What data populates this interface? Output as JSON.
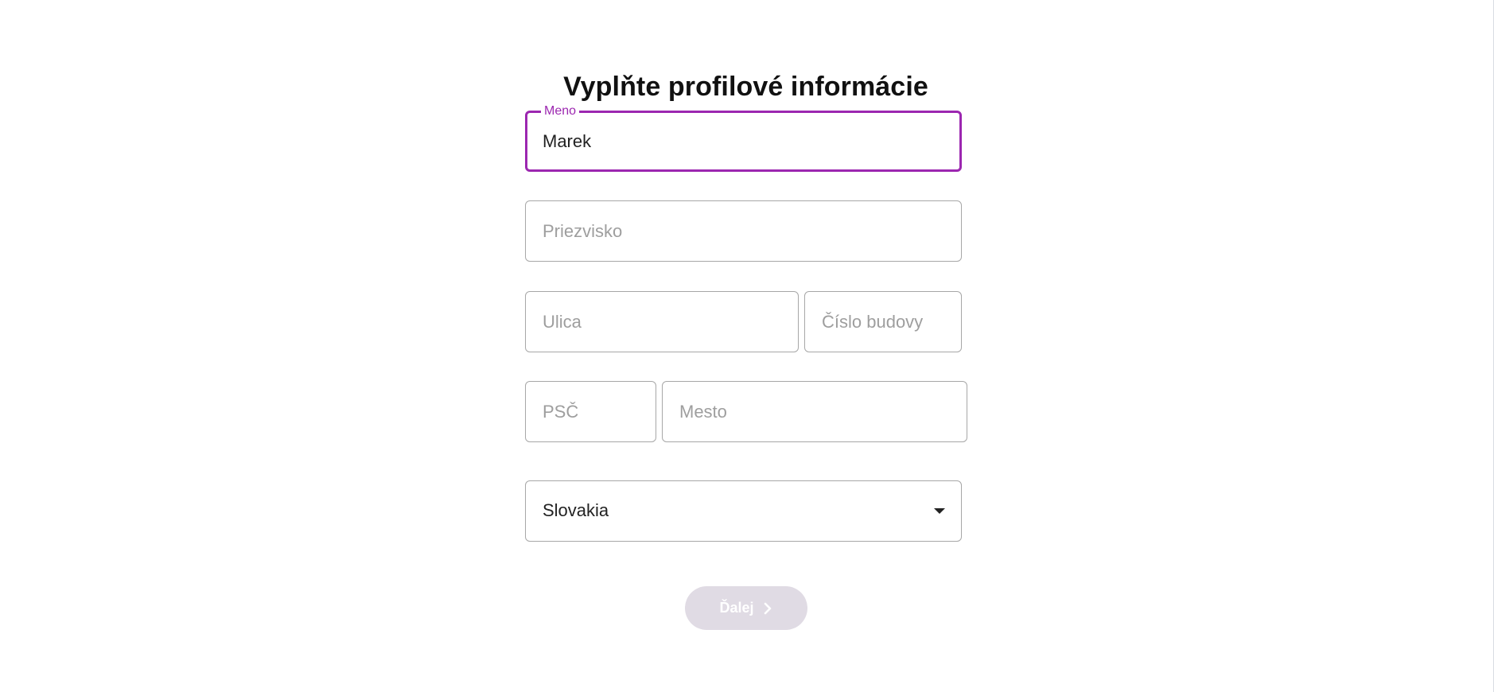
{
  "form": {
    "title": "Vyplňte profilové informácie",
    "first_name": {
      "label": "Meno",
      "value": "Marek"
    },
    "last_name": {
      "placeholder": "Priezvisko"
    },
    "street": {
      "placeholder": "Ulica"
    },
    "building_number": {
      "placeholder": "Číslo budovy"
    },
    "postal_code": {
      "placeholder": "PSČ"
    },
    "city": {
      "placeholder": "Mesto"
    },
    "country": {
      "selected": "Slovakia",
      "icon": "arrow-drop-down-icon"
    },
    "next_button": {
      "label": "Ďalej",
      "icon": "chevron-right-icon",
      "disabled": true
    }
  },
  "colors": {
    "accent": "#9c27b0",
    "border": "#a7a7a7",
    "placeholder": "#9e9e9e",
    "disabled_button": "#e0dbe4"
  }
}
